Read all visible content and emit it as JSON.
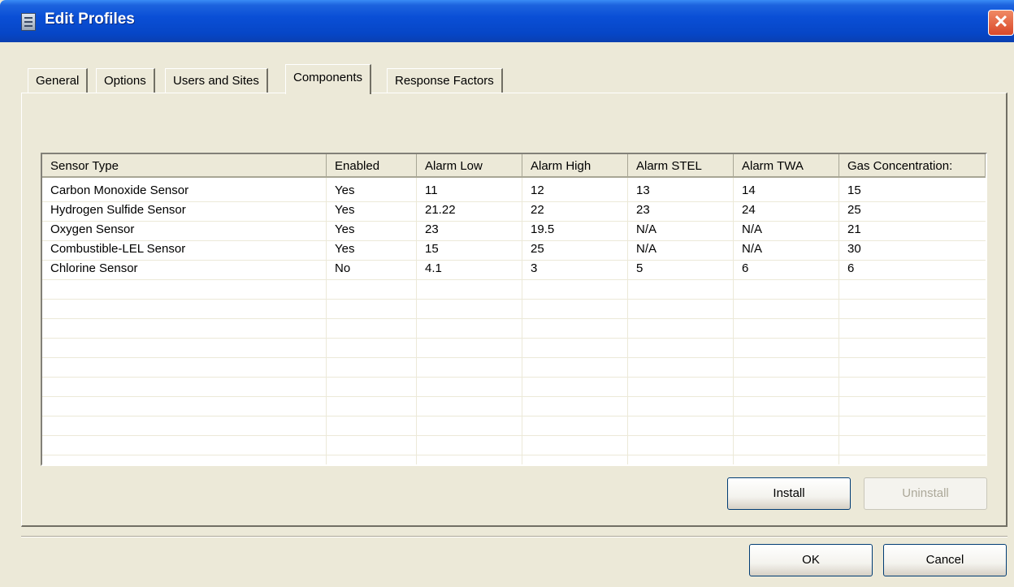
{
  "window": {
    "title": "Edit Profiles",
    "close_glyph": "✕"
  },
  "tabs": [
    "General",
    "Options",
    "Users and Sites",
    "Components",
    "Response Factors"
  ],
  "active_tab": "Components",
  "sensor_list": {
    "headers": [
      "Sensor Type",
      "Enabled",
      "Alarm Low",
      "Alarm High",
      "Alarm STEL",
      "Alarm TWA",
      "Gas Concentration:"
    ],
    "rows": [
      [
        "Carbon Monoxide Sensor",
        "Yes",
        "11",
        "12",
        "13",
        "14",
        "15"
      ],
      [
        "Hydrogen Sulfide Sensor",
        "Yes",
        "21.22",
        "22",
        "23",
        "24",
        "25"
      ],
      [
        "Oxygen Sensor",
        "Yes",
        "23",
        "19.5",
        "N/A",
        "N/A",
        "21"
      ],
      [
        "Combustible-LEL Sensor",
        "Yes",
        "15",
        "25",
        "N/A",
        "N/A",
        "30"
      ],
      [
        "Chlorine Sensor",
        "No",
        "4.1",
        "3",
        "5",
        "6",
        "6"
      ]
    ]
  },
  "buttons": {
    "install": "Install",
    "uninstall": "Uninstall",
    "ok": "OK",
    "cancel": "Cancel"
  },
  "colors": {
    "titlebar": "#0a4fd6",
    "dialog_bg": "#ece9d8",
    "close": "#d9482a"
  }
}
